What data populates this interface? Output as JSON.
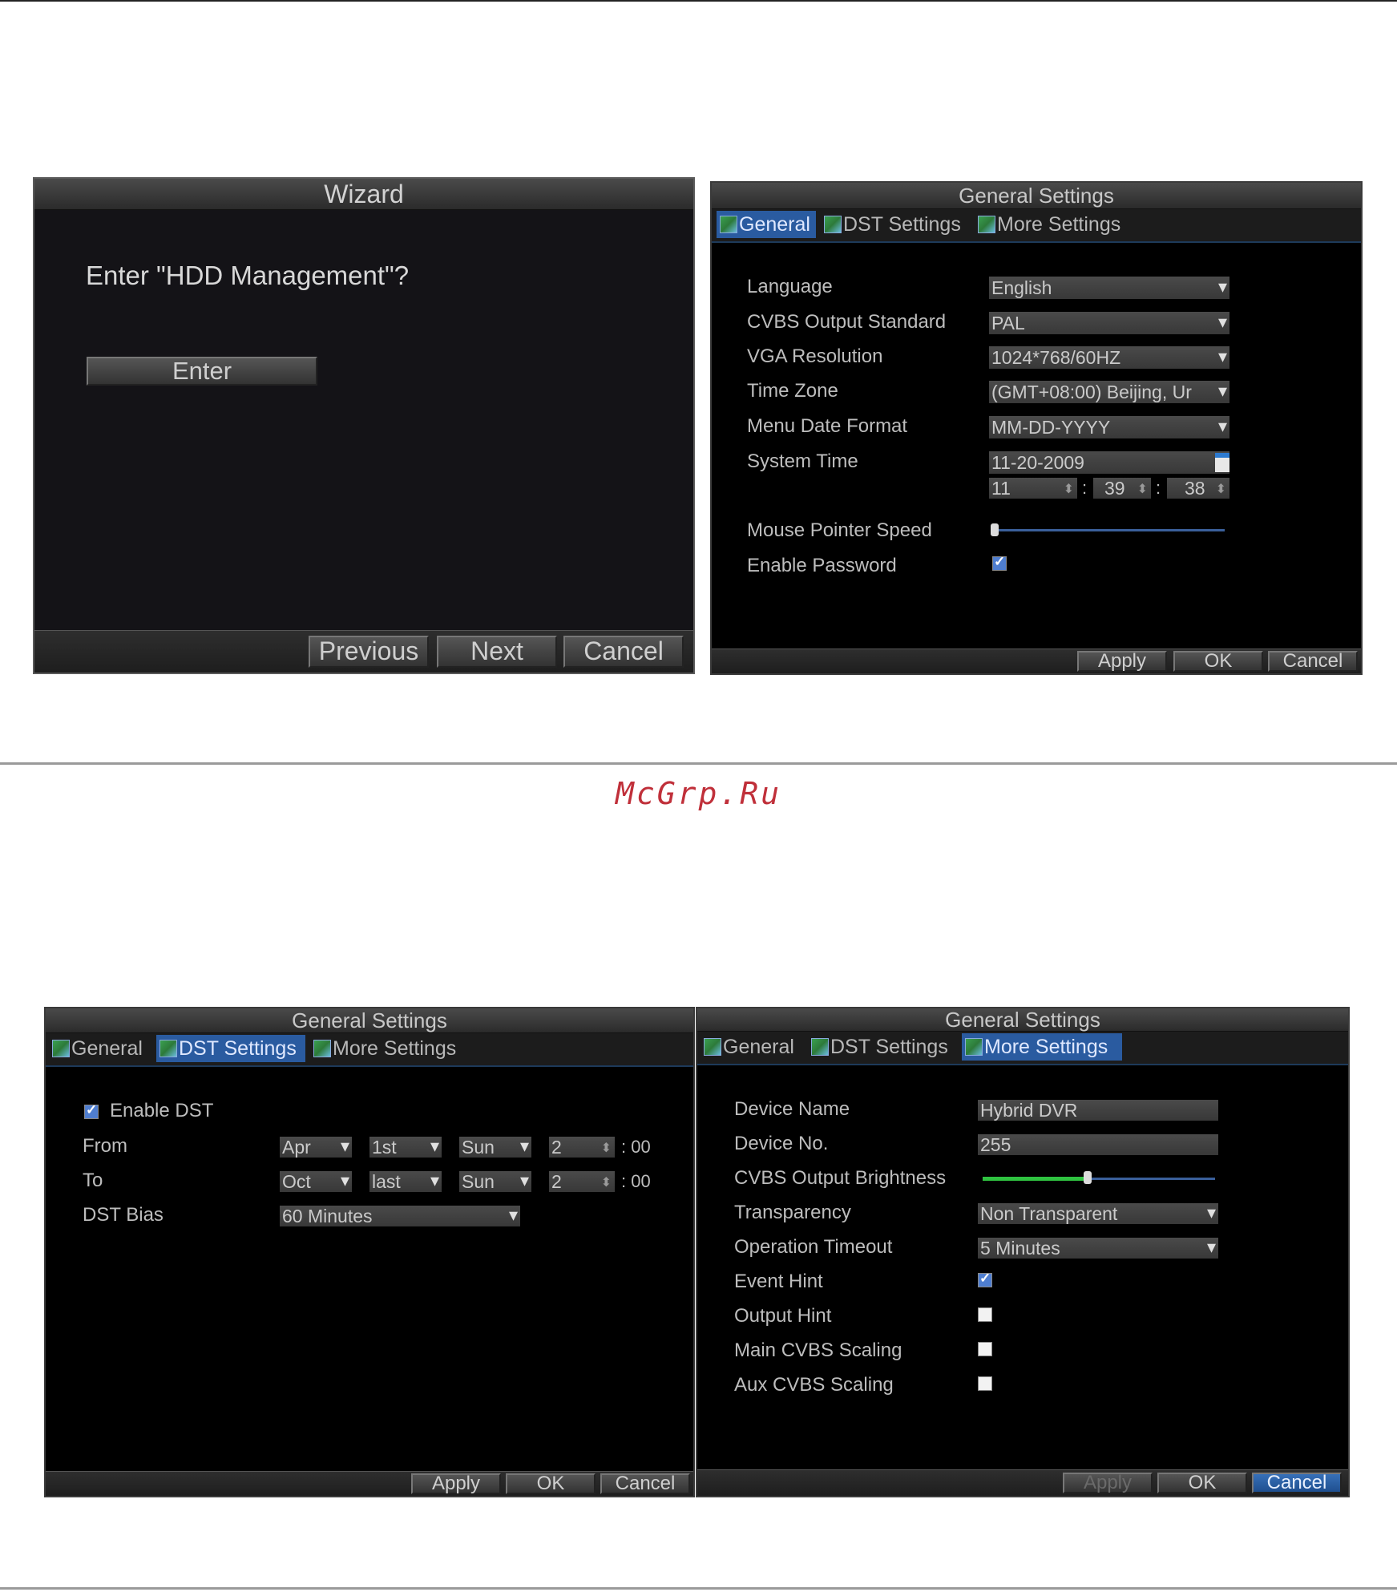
{
  "watermark": "McGrp.Ru",
  "wizard": {
    "title": "Wizard",
    "question": "Enter \"HDD Management\"?",
    "enter_button": "Enter",
    "previous_button": "Previous",
    "next_button": "Next",
    "cancel_button": "Cancel"
  },
  "general_panel": {
    "title": "General Settings",
    "tabs": [
      "General",
      "DST Settings",
      "More Settings"
    ],
    "active_tab": "General",
    "labels": {
      "language": "Language",
      "cvbs_output_standard": "CVBS Output Standard",
      "vga_resolution": "VGA Resolution",
      "time_zone": "Time Zone",
      "menu_date_format": "Menu Date Format",
      "system_time": "System Time",
      "mouse_pointer_speed": "Mouse Pointer Speed",
      "enable_password": "Enable Password"
    },
    "values": {
      "language": "English",
      "cvbs_output_standard": "PAL",
      "vga_resolution": "1024*768/60HZ",
      "time_zone": "(GMT+08:00) Beijing, Ur",
      "menu_date_format": "MM-DD-YYYY",
      "system_date": "11-20-2009",
      "hour": "11",
      "minute": "39",
      "second": "38",
      "time_separator": ":",
      "mouse_pointer_speed_level": 0,
      "enable_password_checked": true
    },
    "apply_button": "Apply",
    "ok_button": "OK",
    "cancel_button": "Cancel"
  },
  "dst_panel": {
    "title": "General Settings",
    "tabs": [
      "General",
      "DST Settings",
      "More Settings"
    ],
    "active_tab": "DST Settings",
    "enable_dst_label": "Enable DST",
    "enable_dst_checked": true,
    "from_label": "From",
    "to_label": "To",
    "dst_bias_label": "DST Bias",
    "from": {
      "month": "Apr",
      "week": "1st",
      "day": "Sun",
      "hour": "2",
      "minutes": ": 00"
    },
    "to": {
      "month": "Oct",
      "week": "last",
      "day": "Sun",
      "hour": "2",
      "minutes": ": 00"
    },
    "dst_bias_value": "60 Minutes",
    "apply_button": "Apply",
    "ok_button": "OK",
    "cancel_button": "Cancel"
  },
  "more_panel": {
    "title": "General Settings",
    "tabs": [
      "General",
      "DST Settings",
      "More Settings"
    ],
    "active_tab": "More Settings",
    "labels": {
      "device_name": "Device Name",
      "device_no": "Device No.",
      "cvbs_output_brightness": "CVBS Output Brightness",
      "transparency": "Transparency",
      "operation_timeout": "Operation Timeout",
      "event_hint": "Event Hint",
      "output_hint": "Output Hint",
      "main_cvbs_scaling": "Main CVBS Scaling",
      "aux_cvbs_scaling": "Aux CVBS Scaling"
    },
    "values": {
      "device_name": "Hybrid DVR",
      "device_no": "255",
      "cvbs_output_brightness_fraction": 0.45,
      "transparency": "Non Transparent",
      "operation_timeout": "5 Minutes",
      "event_hint_checked": true,
      "output_hint_checked": false,
      "main_cvbs_scaling_checked": false,
      "aux_cvbs_scaling_checked": false
    },
    "apply_button": "Apply",
    "ok_button": "OK",
    "cancel_button": "Cancel"
  }
}
